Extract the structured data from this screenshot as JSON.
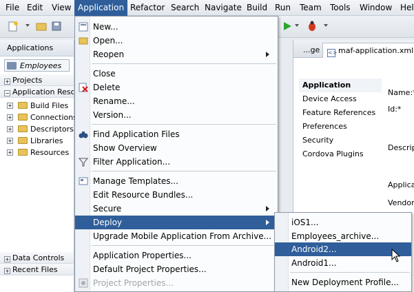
{
  "menubar": {
    "items": [
      "File",
      "Edit",
      "View",
      "Application",
      "Refactor",
      "Search",
      "Navigate",
      "Build",
      "Run",
      "Team",
      "Tools",
      "Window",
      "Help"
    ]
  },
  "left_panel": {
    "title": "Applications",
    "selected_app": "Employees",
    "projects_label": "Projects",
    "app_resources_label": "Application Resources",
    "tree_items": [
      "Build Files",
      "Connections",
      "Descriptors",
      "Libraries",
      "Resources"
    ],
    "data_controls_label": "Data Controls",
    "recent_files_label": "Recent Files"
  },
  "editor": {
    "tabs": [
      "...ge",
      "maf-application.xml"
    ],
    "nav_items": [
      "Application",
      "Device Access",
      "Feature References",
      "Preferences",
      "Security",
      "Cordova Plugins"
    ],
    "field_labels": [
      "Name:*",
      "Id:*",
      "Descript",
      "Applicati",
      "Vendor:"
    ]
  },
  "application_menu": {
    "items": [
      {
        "label": "New...",
        "icon": "new-icon"
      },
      {
        "label": "Open...",
        "icon": "folder-open-icon"
      },
      {
        "label": "Reopen",
        "submenu": true
      },
      {
        "label": "Close"
      },
      {
        "label": "Delete",
        "icon": "delete-icon"
      },
      {
        "label": "Rename..."
      },
      {
        "label": "Version..."
      },
      {
        "label": "Find Application Files",
        "icon": "binoculars-icon"
      },
      {
        "label": "Show Overview"
      },
      {
        "label": "Filter Application...",
        "icon": "filter-icon"
      },
      {
        "label": "Manage Templates...",
        "icon": "templates-icon"
      },
      {
        "label": "Edit Resource Bundles..."
      },
      {
        "label": "Secure",
        "submenu": true
      },
      {
        "label": "Deploy",
        "submenu": true,
        "highlighted": true
      },
      {
        "label": "Upgrade Mobile Application From Archive..."
      },
      {
        "label": "Application Properties..."
      },
      {
        "label": "Default Project Properties..."
      },
      {
        "label": "Project Properties...",
        "disabled": true,
        "icon": "properties-icon"
      }
    ]
  },
  "deploy_submenu": {
    "items": [
      {
        "label": "iOS1..."
      },
      {
        "label": "Employees_archive..."
      },
      {
        "label": "Android2...",
        "highlighted": true
      },
      {
        "label": "Android1..."
      },
      {
        "label": "New Deployment Profile..."
      }
    ]
  },
  "colors": {
    "highlight": "#2f5e9a",
    "menu_bg": "#fbfcfd"
  }
}
